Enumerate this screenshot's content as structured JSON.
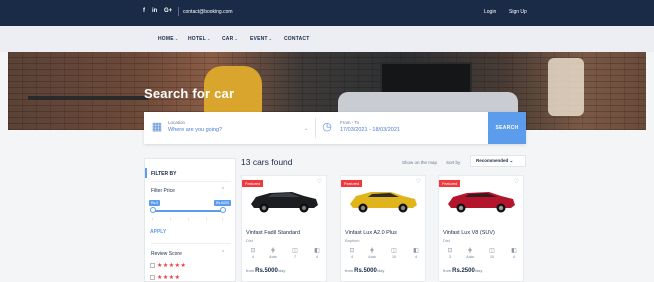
{
  "topbar": {
    "social": [
      "f",
      "in",
      "G+"
    ],
    "email": "contact@booking.com",
    "login": "Login",
    "signup": "Sign Up"
  },
  "nav": {
    "home": "HOME",
    "hotel": "HOTEL",
    "car": "CAR",
    "event": "EVENT",
    "contact": "CONTACT"
  },
  "hero": {
    "title": "Search for car"
  },
  "search": {
    "location_label": "Location",
    "location_placeholder": "Where are you going?",
    "date_label": "From - To",
    "date_value": "17/03/2021 - 18/03/2021",
    "button": "SEARCH"
  },
  "filter": {
    "title": "FILTER BY",
    "price_title": "Filter Price",
    "price_min": "Rs.0",
    "price_max": "Rs.6000",
    "apply": "APPLY",
    "review_title": "Review Score",
    "review_rows": 2
  },
  "results": {
    "count_text": "13 cars found",
    "show_map": "Show on the map",
    "sort_by": "Sort by",
    "sort_value": "Recommended"
  },
  "cars": [
    {
      "badge": "Featured",
      "name": "Vinfast Fadil Standard",
      "sub": "Dist",
      "specs": [
        "4",
        "Auto",
        "7",
        "4"
      ],
      "price_prefix": "from",
      "price": "Rs.5000",
      "unit": "/day",
      "color": "#1c1d20"
    },
    {
      "badge": "Featured",
      "name": "Vinfast Lux A2.0 Plus",
      "sub": "Baptism",
      "specs": [
        "4",
        "Auto",
        "10",
        "4"
      ],
      "price_prefix": "from",
      "price": "Rs.5000",
      "unit": "/day",
      "color": "#e0b51c"
    },
    {
      "badge": "Featured",
      "name": "Vinfast Lux V8 (SUV)",
      "sub": "Dist",
      "specs": [
        "3",
        "Auto",
        "10",
        "4"
      ],
      "price_prefix": "from",
      "price": "Rs.2500",
      "unit": "/day",
      "color": "#b3162c"
    }
  ],
  "colors": {
    "primary": "#5b9cec",
    "navy": "#1a2b48",
    "red": "#f0393e"
  }
}
